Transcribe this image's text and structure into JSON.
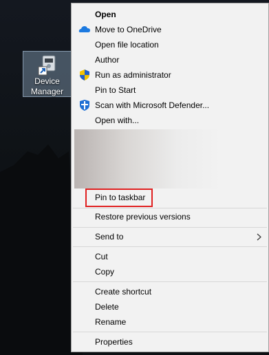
{
  "desktop_icon": {
    "label": "Device Manager",
    "icon": "device-manager-icon"
  },
  "menu": {
    "groups": [
      [
        "Open",
        "Move to OneDrive",
        "Open file location",
        "Author",
        "Run as administrator",
        "Pin to Start",
        "Scan with Microsoft Defender...",
        "Open with..."
      ],
      [
        "Pin to taskbar"
      ],
      [
        "Restore previous versions"
      ],
      [
        "Send to"
      ],
      [
        "Cut",
        "Copy"
      ],
      [
        "Create shortcut",
        "Delete",
        "Rename"
      ],
      [
        "Properties"
      ]
    ],
    "icons": {
      "onedrive": "cloud-icon",
      "admin": "uac-shield-icon",
      "defender": "defender-shield-icon"
    },
    "highlight_color": "#e02020"
  }
}
